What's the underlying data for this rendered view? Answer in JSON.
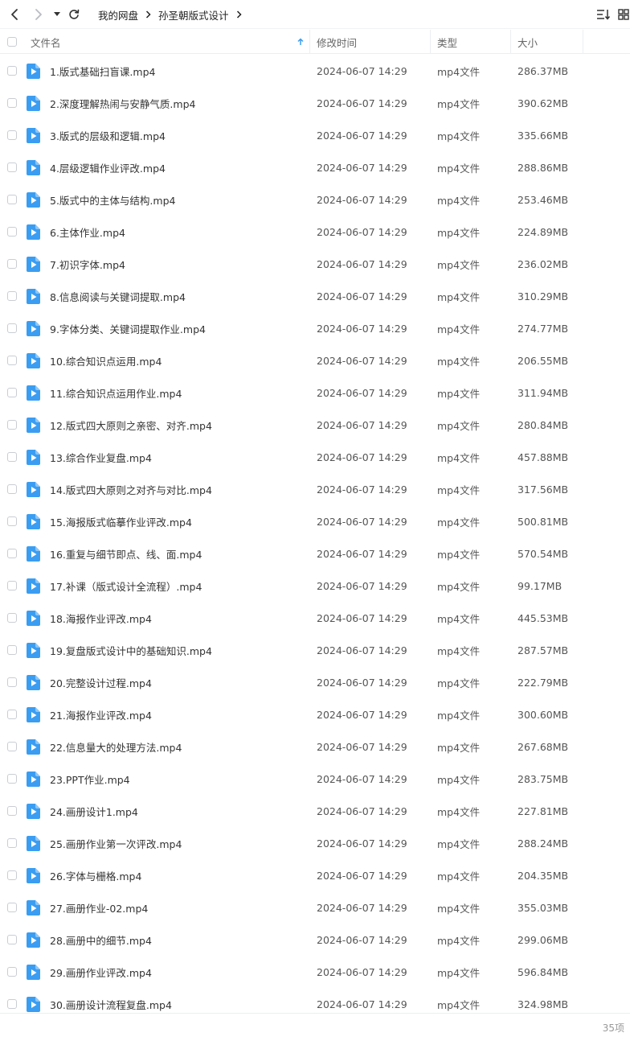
{
  "toolbar": {
    "back_icon": "chevron-left-icon",
    "forward_icon": "chevron-right-icon",
    "history_icon": "caret-down-icon",
    "refresh_icon": "refresh-icon",
    "breadcrumb": [
      "我的网盘",
      "孙圣朝版式设计"
    ],
    "sort_icon": "sort-list-icon",
    "view_icon": "grid-view-icon"
  },
  "table": {
    "columns": {
      "name": "文件名",
      "modified": "修改时间",
      "type": "类型",
      "size": "大小"
    },
    "sort_indicator_icon": "sort-ascending-icon",
    "file_icon": "video-file-icon",
    "accent_color": "#3b9df1",
    "rows": [
      {
        "name": "1.版式基础扫盲课.mp4",
        "modified": "2024-06-07 14:29",
        "type": "mp4文件",
        "size": "286.37MB"
      },
      {
        "name": "2.深度理解热闹与安静气质.mp4",
        "modified": "2024-06-07 14:29",
        "type": "mp4文件",
        "size": "390.62MB"
      },
      {
        "name": "3.版式的层级和逻辑.mp4",
        "modified": "2024-06-07 14:29",
        "type": "mp4文件",
        "size": "335.66MB"
      },
      {
        "name": "4.层级逻辑作业评改.mp4",
        "modified": "2024-06-07 14:29",
        "type": "mp4文件",
        "size": "288.86MB"
      },
      {
        "name": "5.版式中的主体与结构.mp4",
        "modified": "2024-06-07 14:29",
        "type": "mp4文件",
        "size": "253.46MB"
      },
      {
        "name": "6.主体作业.mp4",
        "modified": "2024-06-07 14:29",
        "type": "mp4文件",
        "size": "224.89MB"
      },
      {
        "name": "7.初识字体.mp4",
        "modified": "2024-06-07 14:29",
        "type": "mp4文件",
        "size": "236.02MB"
      },
      {
        "name": "8.信息阅读与关键词提取.mp4",
        "modified": "2024-06-07 14:29",
        "type": "mp4文件",
        "size": "310.29MB"
      },
      {
        "name": "9.字体分类、关键词提取作业.mp4",
        "modified": "2024-06-07 14:29",
        "type": "mp4文件",
        "size": "274.77MB"
      },
      {
        "name": "10.综合知识点运用.mp4",
        "modified": "2024-06-07 14:29",
        "type": "mp4文件",
        "size": "206.55MB"
      },
      {
        "name": "11.综合知识点运用作业.mp4",
        "modified": "2024-06-07 14:29",
        "type": "mp4文件",
        "size": "311.94MB"
      },
      {
        "name": "12.版式四大原则之亲密、对齐.mp4",
        "modified": "2024-06-07 14:29",
        "type": "mp4文件",
        "size": "280.84MB"
      },
      {
        "name": "13.综合作业复盘.mp4",
        "modified": "2024-06-07 14:29",
        "type": "mp4文件",
        "size": "457.88MB"
      },
      {
        "name": "14.版式四大原则之对齐与对比.mp4",
        "modified": "2024-06-07 14:29",
        "type": "mp4文件",
        "size": "317.56MB"
      },
      {
        "name": "15.海报版式临摹作业评改.mp4",
        "modified": "2024-06-07 14:29",
        "type": "mp4文件",
        "size": "500.81MB"
      },
      {
        "name": "16.重复与细节即点、线、面.mp4",
        "modified": "2024-06-07 14:29",
        "type": "mp4文件",
        "size": "570.54MB"
      },
      {
        "name": "17.补课（版式设计全流程）.mp4",
        "modified": "2024-06-07 14:29",
        "type": "mp4文件",
        "size": "99.17MB"
      },
      {
        "name": "18.海报作业评改.mp4",
        "modified": "2024-06-07 14:29",
        "type": "mp4文件",
        "size": "445.53MB"
      },
      {
        "name": "19.复盘版式设计中的基础知识.mp4",
        "modified": "2024-06-07 14:29",
        "type": "mp4文件",
        "size": "287.57MB"
      },
      {
        "name": "20.完整设计过程.mp4",
        "modified": "2024-06-07 14:29",
        "type": "mp4文件",
        "size": "222.79MB"
      },
      {
        "name": "21.海报作业评改.mp4",
        "modified": "2024-06-07 14:29",
        "type": "mp4文件",
        "size": "300.60MB"
      },
      {
        "name": "22.信息量大的处理方法.mp4",
        "modified": "2024-06-07 14:29",
        "type": "mp4文件",
        "size": "267.68MB"
      },
      {
        "name": "23.PPT作业.mp4",
        "modified": "2024-06-07 14:29",
        "type": "mp4文件",
        "size": "283.75MB"
      },
      {
        "name": "24.画册设计1.mp4",
        "modified": "2024-06-07 14:29",
        "type": "mp4文件",
        "size": "227.81MB"
      },
      {
        "name": "25.画册作业第一次评改.mp4",
        "modified": "2024-06-07 14:29",
        "type": "mp4文件",
        "size": "288.24MB"
      },
      {
        "name": "26.字体与栅格.mp4",
        "modified": "2024-06-07 14:29",
        "type": "mp4文件",
        "size": "204.35MB"
      },
      {
        "name": "27.画册作业-02.mp4",
        "modified": "2024-06-07 14:29",
        "type": "mp4文件",
        "size": "355.03MB"
      },
      {
        "name": "28.画册中的细节.mp4",
        "modified": "2024-06-07 14:29",
        "type": "mp4文件",
        "size": "299.06MB"
      },
      {
        "name": "29.画册作业评改.mp4",
        "modified": "2024-06-07 14:29",
        "type": "mp4文件",
        "size": "596.84MB"
      },
      {
        "name": "30.画册设计流程复盘.mp4",
        "modified": "2024-06-07 14:29",
        "type": "mp4文件",
        "size": "324.98MB"
      }
    ]
  },
  "footer": {
    "item_count": "35项"
  }
}
